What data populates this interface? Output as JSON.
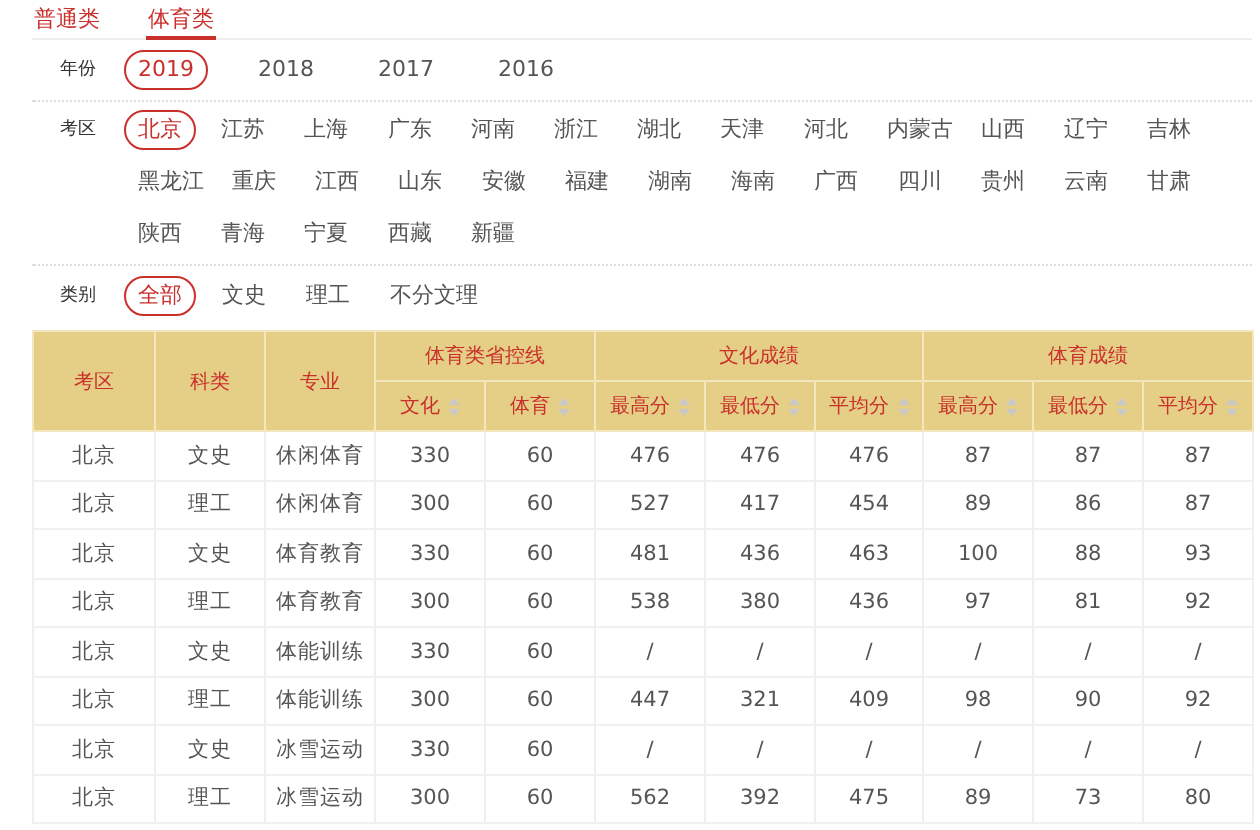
{
  "tabs": [
    {
      "label": "普通类",
      "selected": false
    },
    {
      "label": "体育类",
      "selected": true
    }
  ],
  "filters": [
    {
      "label": "年份",
      "kind": "year",
      "options": [
        {
          "label": "2019",
          "selected": true
        },
        {
          "label": "2018",
          "selected": false
        },
        {
          "label": "2017",
          "selected": false
        },
        {
          "label": "2016",
          "selected": false
        }
      ]
    },
    {
      "label": "考区",
      "kind": "region",
      "options": [
        {
          "label": "北京",
          "selected": true
        },
        {
          "label": "江苏",
          "selected": false
        },
        {
          "label": "上海",
          "selected": false
        },
        {
          "label": "广东",
          "selected": false
        },
        {
          "label": "河南",
          "selected": false
        },
        {
          "label": "浙江",
          "selected": false
        },
        {
          "label": "湖北",
          "selected": false
        },
        {
          "label": "天津",
          "selected": false
        },
        {
          "label": "河北",
          "selected": false
        },
        {
          "label": "内蒙古",
          "selected": false
        },
        {
          "label": "山西",
          "selected": false
        },
        {
          "label": "辽宁",
          "selected": false
        },
        {
          "label": "吉林",
          "selected": false
        },
        {
          "label": "黑龙江",
          "selected": false
        },
        {
          "label": "重庆",
          "selected": false
        },
        {
          "label": "江西",
          "selected": false
        },
        {
          "label": "山东",
          "selected": false
        },
        {
          "label": "安徽",
          "selected": false
        },
        {
          "label": "福建",
          "selected": false
        },
        {
          "label": "湖南",
          "selected": false
        },
        {
          "label": "海南",
          "selected": false
        },
        {
          "label": "广西",
          "selected": false
        },
        {
          "label": "四川",
          "selected": false
        },
        {
          "label": "贵州",
          "selected": false
        },
        {
          "label": "云南",
          "selected": false
        },
        {
          "label": "甘肃",
          "selected": false
        },
        {
          "label": "陕西",
          "selected": false
        },
        {
          "label": "青海",
          "selected": false
        },
        {
          "label": "宁夏",
          "selected": false
        },
        {
          "label": "西藏",
          "selected": false
        },
        {
          "label": "新疆",
          "selected": false
        }
      ]
    },
    {
      "label": "类别",
      "kind": "category",
      "options": [
        {
          "label": "全部",
          "selected": true
        },
        {
          "label": "文史",
          "selected": false
        },
        {
          "label": "理工",
          "selected": false
        },
        {
          "label": "不分文理",
          "selected": false
        }
      ]
    }
  ],
  "table": {
    "header": [
      {
        "label": "考区",
        "sortable": false
      },
      {
        "label": "科类",
        "sortable": false
      },
      {
        "label": "专业",
        "sortable": false
      },
      {
        "label": "体育类省控线",
        "children": [
          {
            "label": "文化",
            "sortable": true
          },
          {
            "label": "体育",
            "sortable": true
          }
        ]
      },
      {
        "label": "文化成绩",
        "children": [
          {
            "label": "最高分",
            "sortable": true
          },
          {
            "label": "最低分",
            "sortable": true
          },
          {
            "label": "平均分",
            "sortable": true
          }
        ]
      },
      {
        "label": "体育成绩",
        "children": [
          {
            "label": "最高分",
            "sortable": true
          },
          {
            "label": "最低分",
            "sortable": true
          },
          {
            "label": "平均分",
            "sortable": true
          }
        ]
      }
    ],
    "rows": [
      [
        "北京",
        "文史",
        "休闲体育",
        "330",
        "60",
        "476",
        "476",
        "476",
        "87",
        "87",
        "87"
      ],
      [
        "北京",
        "理工",
        "休闲体育",
        "300",
        "60",
        "527",
        "417",
        "454",
        "89",
        "86",
        "87"
      ],
      [
        "北京",
        "文史",
        "体育教育",
        "330",
        "60",
        "481",
        "436",
        "463",
        "100",
        "88",
        "93"
      ],
      [
        "北京",
        "理工",
        "体育教育",
        "300",
        "60",
        "538",
        "380",
        "436",
        "97",
        "81",
        "92"
      ],
      [
        "北京",
        "文史",
        "体能训练",
        "330",
        "60",
        "/",
        "/",
        "/",
        "/",
        "/",
        "/"
      ],
      [
        "北京",
        "理工",
        "体能训练",
        "300",
        "60",
        "447",
        "321",
        "409",
        "98",
        "90",
        "92"
      ],
      [
        "北京",
        "文史",
        "冰雪运动",
        "330",
        "60",
        "/",
        "/",
        "/",
        "/",
        "/",
        "/"
      ],
      [
        "北京",
        "理工",
        "冰雪运动",
        "300",
        "60",
        "562",
        "392",
        "475",
        "89",
        "73",
        "80"
      ]
    ]
  }
}
